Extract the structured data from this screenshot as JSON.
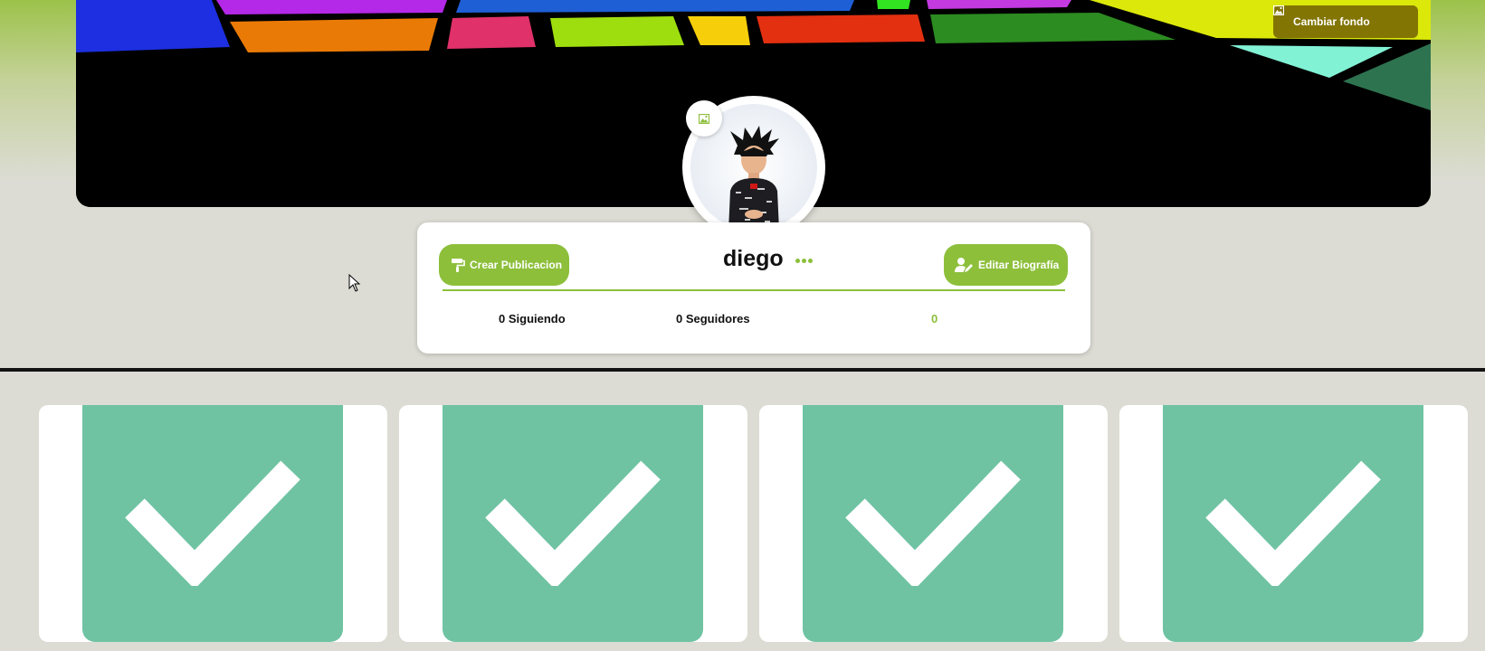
{
  "cover": {
    "change_background_label": "Cambiar fondo"
  },
  "profile": {
    "username": "diego",
    "create_post_label": "Crear Publicacion",
    "edit_bio_label": "Editar Biografía",
    "stats": {
      "following": "0 Siguiendo",
      "followers": "0 Seguidores",
      "extra": "0"
    }
  },
  "posts": [
    {
      "icon": "checkmark-icon"
    },
    {
      "icon": "checkmark-icon"
    },
    {
      "icon": "checkmark-icon"
    },
    {
      "icon": "checkmark-icon"
    }
  ],
  "colors": {
    "accent": "#8dbf3b",
    "tile_green": "#6fc3a3"
  }
}
